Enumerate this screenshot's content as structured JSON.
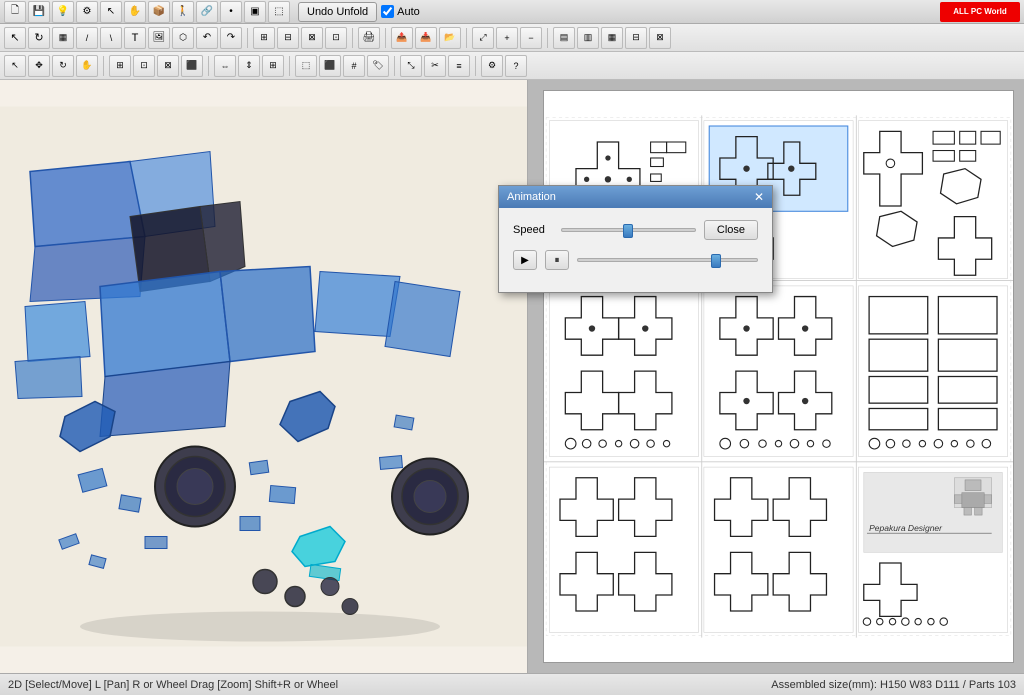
{
  "app": {
    "title": "Pepakura Designer"
  },
  "titlebar": {
    "undo_unfold": "Undo Unfold",
    "auto_label": "Auto",
    "logo_text": "ALL PC World"
  },
  "toolbar1": {
    "buttons": [
      "💾",
      "📁",
      "🖨",
      "✂",
      "📋",
      "↩",
      "↪",
      "🔍",
      "🔲",
      "⬜",
      "↕",
      "↔",
      "⤢",
      "⊞",
      "⊟",
      "◫",
      "⬡",
      "🔷",
      "📐",
      "T",
      "🖼",
      "🔄",
      "↶",
      "↷",
      "⊞",
      "⊠",
      "⊡",
      "⊟",
      "⊞",
      "⊡",
      "⊠",
      "⊟",
      "⊞",
      "⊡"
    ]
  },
  "animation": {
    "title": "Animation",
    "speed_label": "Speed",
    "close_label": "Close",
    "speed_value": 55,
    "progress_value": 75
  },
  "statusbar": {
    "left": "2D [Select/Move] L [Pan] R or Wheel Drag [Zoom] Shift+R or Wheel",
    "right": "Assembled size(mm): H150 W83 D111 / Parts 103"
  },
  "paper": {
    "watermark_name": "Pepakura Designer"
  }
}
